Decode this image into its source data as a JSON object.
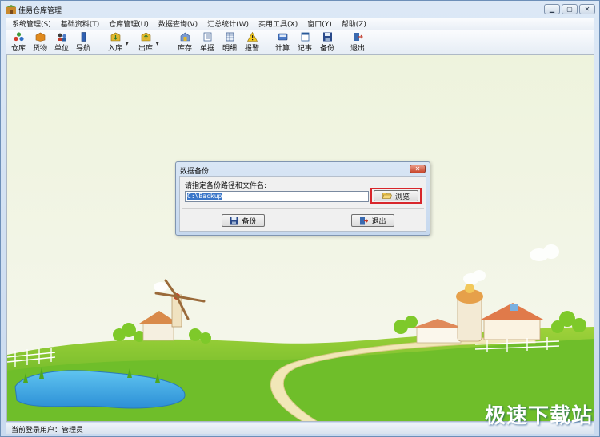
{
  "window": {
    "title": "佳易仓库管理"
  },
  "menu": [
    "系统管理(S)",
    "基础资料(T)",
    "仓库管理(U)",
    "数据查询(V)",
    "汇总统计(W)",
    "实用工具(X)",
    "窗口(Y)",
    "帮助(Z)"
  ],
  "toolbar": {
    "warehouse": "仓库",
    "goods": "货物",
    "unit": "单位",
    "nav": "导航",
    "inbound": "入库",
    "outbound": "出库",
    "stock": "库存",
    "documents": "单据",
    "detail": "明细",
    "alarm": "报警",
    "calc": "计算",
    "notes": "记事",
    "backup": "备份",
    "exit": "退出"
  },
  "dialog": {
    "title": "数据备份",
    "prompt": "请指定备份路径和文件名:",
    "path_value": "C:\\Backup",
    "browse_label": "浏览",
    "backup_label": "备份",
    "exit_label": "退出"
  },
  "status": {
    "text": "当前登录用户：管理员"
  },
  "watermark": {
    "text": "极速下载站"
  },
  "colors": {
    "highlight_border": "#d8262b",
    "selection": "#3a76c9"
  }
}
